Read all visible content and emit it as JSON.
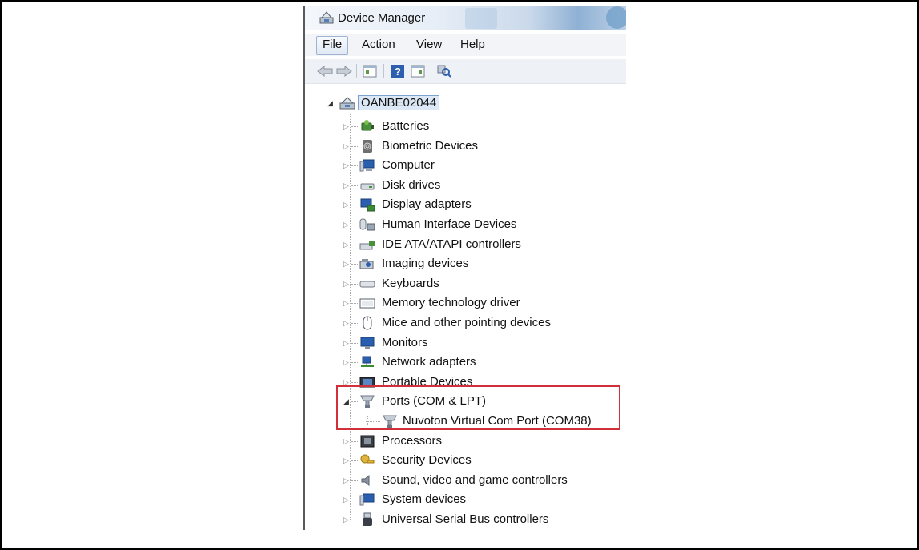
{
  "window": {
    "title": "Device Manager",
    "icon": "device-manager-icon"
  },
  "menu": {
    "items": [
      "File",
      "Action",
      "View",
      "Help"
    ],
    "active": "File"
  },
  "toolbar": {
    "buttons": [
      "back-arrow-icon",
      "forward-arrow-icon",
      "properties-icon",
      "help-icon",
      "view-icon",
      "scan-hardware-icon"
    ]
  },
  "tree": {
    "root": "OANBE02044",
    "categories": [
      {
        "label": "Batteries",
        "icon": "battery-icon"
      },
      {
        "label": "Biometric Devices",
        "icon": "fingerprint-icon"
      },
      {
        "label": "Computer",
        "icon": "computer-icon"
      },
      {
        "label": "Disk drives",
        "icon": "disk-drive-icon"
      },
      {
        "label": "Display adapters",
        "icon": "display-adapter-icon"
      },
      {
        "label": "Human Interface Devices",
        "icon": "hid-icon"
      },
      {
        "label": "IDE ATA/ATAPI controllers",
        "icon": "ide-controller-icon"
      },
      {
        "label": "Imaging devices",
        "icon": "camera-icon"
      },
      {
        "label": "Keyboards",
        "icon": "keyboard-icon"
      },
      {
        "label": "Memory technology driver",
        "icon": "memory-icon"
      },
      {
        "label": "Mice and other pointing devices",
        "icon": "mouse-icon"
      },
      {
        "label": "Monitors",
        "icon": "monitor-icon"
      },
      {
        "label": "Network adapters",
        "icon": "network-adapter-icon"
      },
      {
        "label": "Portable Devices",
        "icon": "portable-device-icon"
      },
      {
        "label": "Ports (COM & LPT)",
        "icon": "port-icon",
        "expanded": true,
        "children": [
          {
            "label": "Nuvoton Virtual Com Port (COM38)",
            "icon": "port-icon"
          }
        ]
      },
      {
        "label": "Processors",
        "icon": "processor-icon"
      },
      {
        "label": "Security Devices",
        "icon": "security-key-icon"
      },
      {
        "label": "Sound, video and game controllers",
        "icon": "speaker-icon"
      },
      {
        "label": "System devices",
        "icon": "system-device-icon"
      },
      {
        "label": "Universal Serial Bus controllers",
        "icon": "usb-icon"
      }
    ]
  },
  "colors": {
    "highlight_box": "#d1303a",
    "selection": "#dce8f6"
  }
}
